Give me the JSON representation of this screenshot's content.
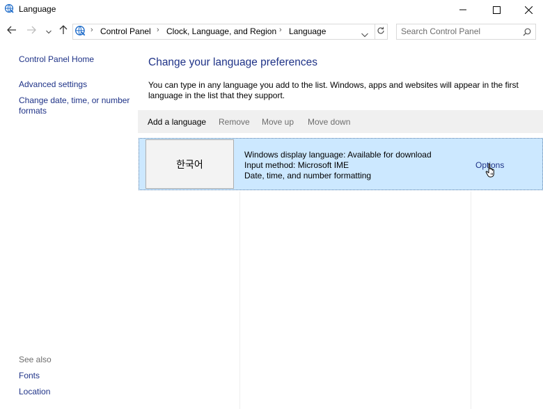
{
  "window": {
    "title": "Language"
  },
  "breadcrumbs": [
    "Control Panel",
    "Clock, Language, and Region",
    "Language"
  ],
  "search": {
    "placeholder": "Search Control Panel"
  },
  "left_pane": {
    "home": "Control Panel Home",
    "advanced": "Advanced settings",
    "date_time_line1": "Change date, time, or number",
    "date_time_line2": "formats",
    "see_also_title": "See also",
    "fonts": "Fonts",
    "location": "Location"
  },
  "main": {
    "heading": "Change your language preferences",
    "description_line1": "You can type in any language you add to the list. Windows, apps and websites will appear in the first",
    "description_line2": "language in the list that they support.",
    "toolbar": {
      "add": "Add a language",
      "remove": "Remove",
      "move_up": "Move up",
      "move_down": "Move down"
    },
    "language": {
      "name": "한국어",
      "display": "Windows display language: Available for download",
      "input": "Input method: Microsoft IME",
      "formatting": "Date, time, and number formatting",
      "options": "Options"
    }
  },
  "colors": {
    "link": "#1e3287",
    "selection": "#cce8ff",
    "toolbar": "#f0f0f0",
    "disabled": "#6d6d6d"
  },
  "icons": [
    "language-app-icon",
    "minimize-icon",
    "maximize-icon",
    "close-icon",
    "back-arrow-icon",
    "forward-arrow-icon",
    "recent-chevron-icon",
    "up-arrow-icon",
    "dropdown-chevron-icon",
    "refresh-icon",
    "search-icon",
    "hand-cursor-icon"
  ]
}
